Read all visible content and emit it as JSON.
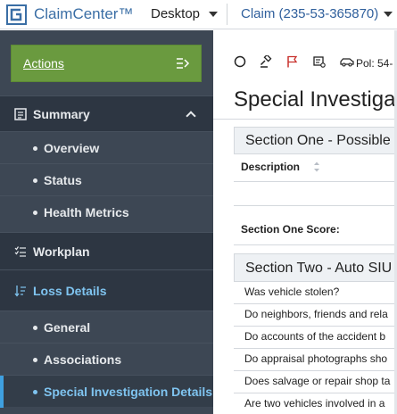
{
  "header": {
    "brand": "ClaimCenter™",
    "tab_desktop": "Desktop",
    "tab_claim": "Claim (235-53-365870)"
  },
  "sidebar": {
    "actions_label": "Actions",
    "summary_label": "Summary",
    "summary_items": [
      "Overview",
      "Status",
      "Health Metrics"
    ],
    "workplan_label": "Workplan",
    "loss_details_label": "Loss Details",
    "loss_items": [
      "General",
      "Associations",
      "Special Investigation Details"
    ]
  },
  "main": {
    "policy_label": "Pol: 54-",
    "page_title": "Special Investiga",
    "section_one_title": "Section One - Possible f",
    "description_header": "Description",
    "section_one_score": "Section One Score:",
    "section_two_title": "Section Two - Auto SIU",
    "questions": [
      "Was vehicle stolen?",
      "Do neighbors, friends and rela",
      "Do accounts of the accident b",
      "Do appraisal photographs sho",
      "Does salvage or repair shop ta",
      "Are two vehicles involved in a"
    ]
  },
  "colors": {
    "sidebar_bg": "#3d4754",
    "actions_green": "#6a9a3f",
    "active_blue": "#3fa0e0",
    "brand_blue": "#3a6ea5"
  },
  "icons": [
    "claimcenter-logo-icon",
    "chevron-down-icon",
    "actions-menu-icon",
    "summary-icon",
    "chevron-up-icon",
    "workplan-icon",
    "loss-details-icon",
    "circle-icon",
    "gavel-icon",
    "flag-icon",
    "vehicle-id-icon",
    "car-icon",
    "sort-icon"
  ]
}
